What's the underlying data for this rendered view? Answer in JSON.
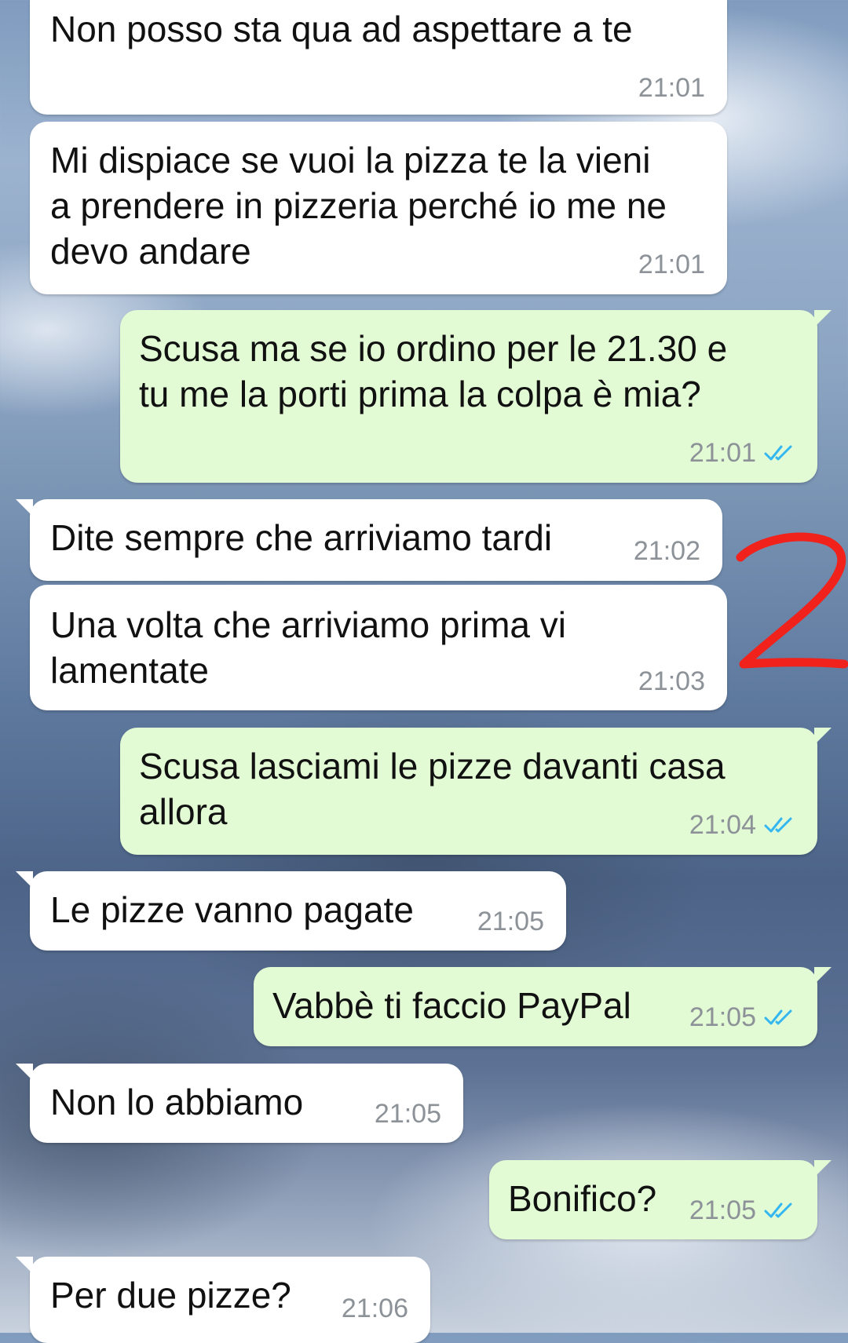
{
  "messages": [
    {
      "side": "in",
      "lines": [
        "Non posso sta qua ad aspettare a te"
      ],
      "time": "21:01"
    },
    {
      "side": "in",
      "lines": [
        "Mi dispiace se vuoi la pizza te la vieni",
        "a prendere in pizzeria perché io me ne",
        "devo andare"
      ],
      "time": "21:01"
    },
    {
      "side": "out",
      "lines": [
        "Scusa ma se io ordino per le 21.30 e",
        "tu me la porti prima la colpa è mia?"
      ],
      "time": "21:01",
      "status": "read"
    },
    {
      "side": "in",
      "lines": [
        "Dite sempre che arriviamo tardi"
      ],
      "time": "21:02"
    },
    {
      "side": "in",
      "lines": [
        "Una volta che arriviamo prima vi",
        "lamentate"
      ],
      "time": "21:03"
    },
    {
      "side": "out",
      "lines": [
        "Scusa lasciami le pizze davanti casa",
        "allora"
      ],
      "time": "21:04",
      "status": "read"
    },
    {
      "side": "in",
      "lines": [
        "Le pizze vanno pagate"
      ],
      "time": "21:05"
    },
    {
      "side": "out",
      "lines": [
        "Vabbè ti faccio PayPal"
      ],
      "time": "21:05",
      "status": "read"
    },
    {
      "side": "in",
      "lines": [
        "Non lo abbiamo"
      ],
      "time": "21:05"
    },
    {
      "side": "out",
      "lines": [
        "Bonifico?"
      ],
      "time": "21:05",
      "status": "read"
    },
    {
      "side": "in",
      "lines": [
        "Per due pizze?"
      ],
      "time": "21:06"
    }
  ],
  "annotation": {
    "text": "2",
    "color": "#f0221b"
  },
  "colors": {
    "incoming": "#ffffff",
    "outgoing": "#e2fbd5",
    "read_ticks": "#34b7f1",
    "timestamp": "#8c9297"
  },
  "icons": {
    "read_receipt": "double-check-icon"
  }
}
